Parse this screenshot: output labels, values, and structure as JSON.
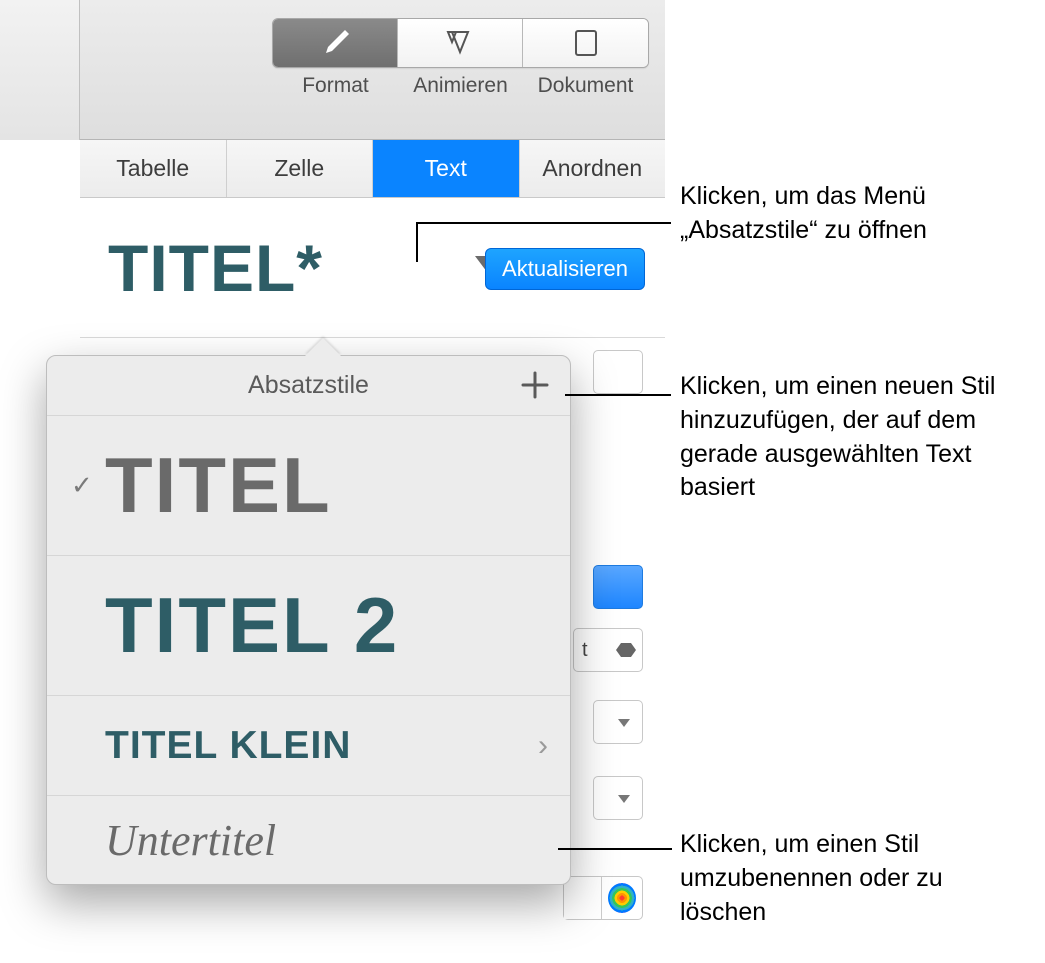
{
  "toolbar": {
    "format": "Format",
    "animate": "Animieren",
    "document": "Dokument"
  },
  "inspector_tabs": {
    "table": "Tabelle",
    "cell": "Zelle",
    "text": "Text",
    "arrange": "Anordnen"
  },
  "style_row": {
    "style_name": "TITEL*",
    "update_label": "Aktualisieren"
  },
  "popover": {
    "title": "Absatzstile",
    "items": [
      {
        "label": "TITEL",
        "checked": true,
        "variant": "big_grey",
        "chevron": false
      },
      {
        "label": "TITEL 2",
        "checked": false,
        "variant": "big_teal",
        "chevron": false
      },
      {
        "label": "TITEL KLEIN",
        "checked": false,
        "variant": "med_teal",
        "chevron": true
      },
      {
        "label": "Untertitel",
        "checked": false,
        "variant": "subtitle",
        "chevron": false
      }
    ]
  },
  "hidden_controls": {
    "stepper_value": "t"
  },
  "callouts": {
    "open_menu": "Klicken, um das Menü „Absatzstile“ zu öffnen",
    "add_style": "Klicken, um einen neuen Stil hinzuzufügen, der auf dem gerade ausgewählten Text basiert",
    "rename_delete": "Klicken, um einen Stil umzubenennen oder zu löschen"
  }
}
